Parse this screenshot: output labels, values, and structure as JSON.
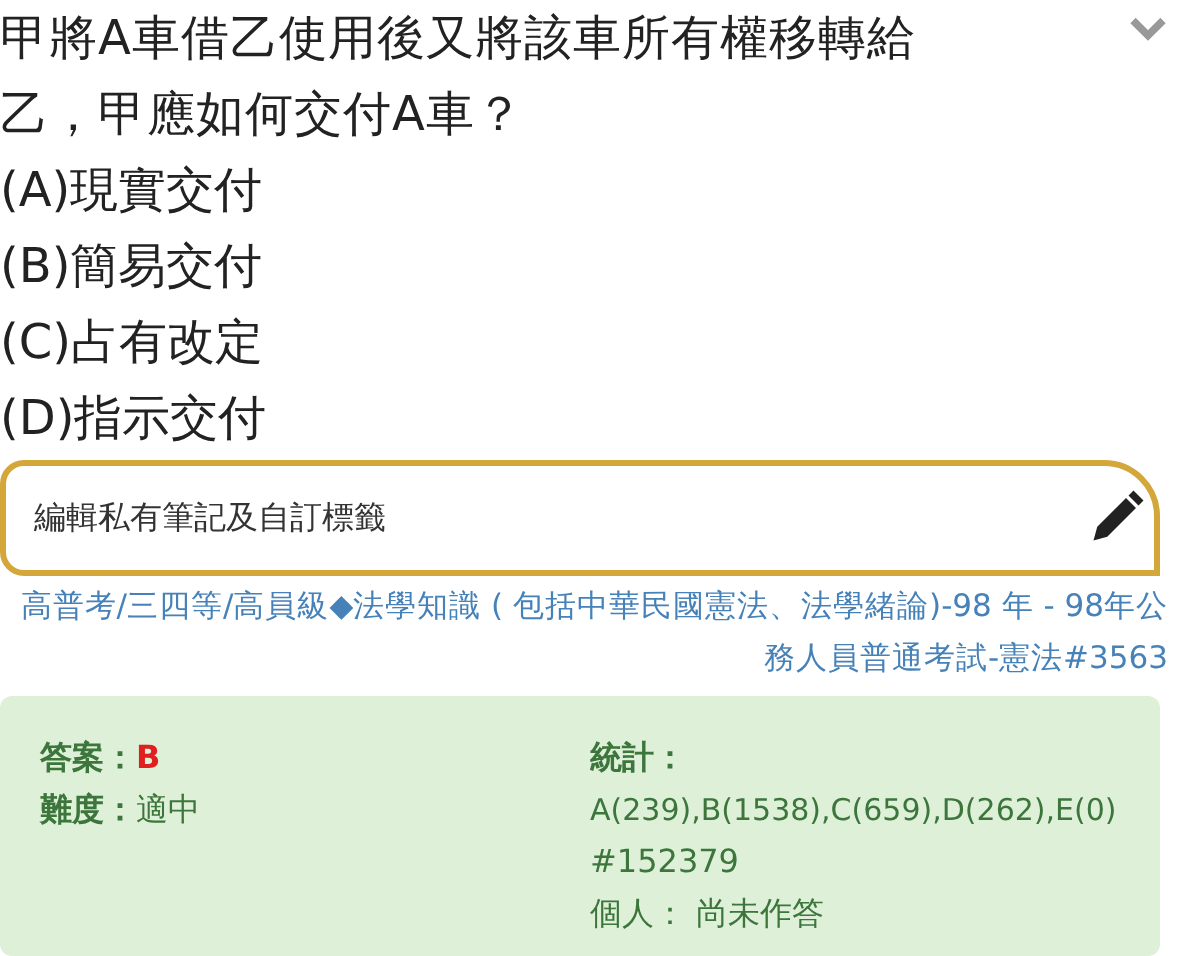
{
  "question": {
    "text": "甲將A車借乙使用後又將該車所有權移轉給乙，甲應如何交付A車？",
    "expanded": false
  },
  "options": [
    {
      "text": "(A)現實交付"
    },
    {
      "text": "(B)簡易交付"
    },
    {
      "text": "(C)占有改定"
    },
    {
      "text": "(D)指示交付"
    }
  ],
  "note_field": {
    "placeholder": "編輯私有筆記及自訂標籤"
  },
  "category_link": "高普考/三四等/高員級◆法學知識 ( 包括中華民國憲法、法學緒論)-98 年 - 98年公務人員普通考試-憲法#3563",
  "answer": {
    "label": "答案：",
    "value": "B"
  },
  "difficulty": {
    "label": "難度：",
    "value": "適中"
  },
  "stats": {
    "label": "統計：",
    "counts": "A(239),B(1538),C(659),D(262),E(0)",
    "id": "#152379",
    "personal": "個人： 尚未作答"
  }
}
